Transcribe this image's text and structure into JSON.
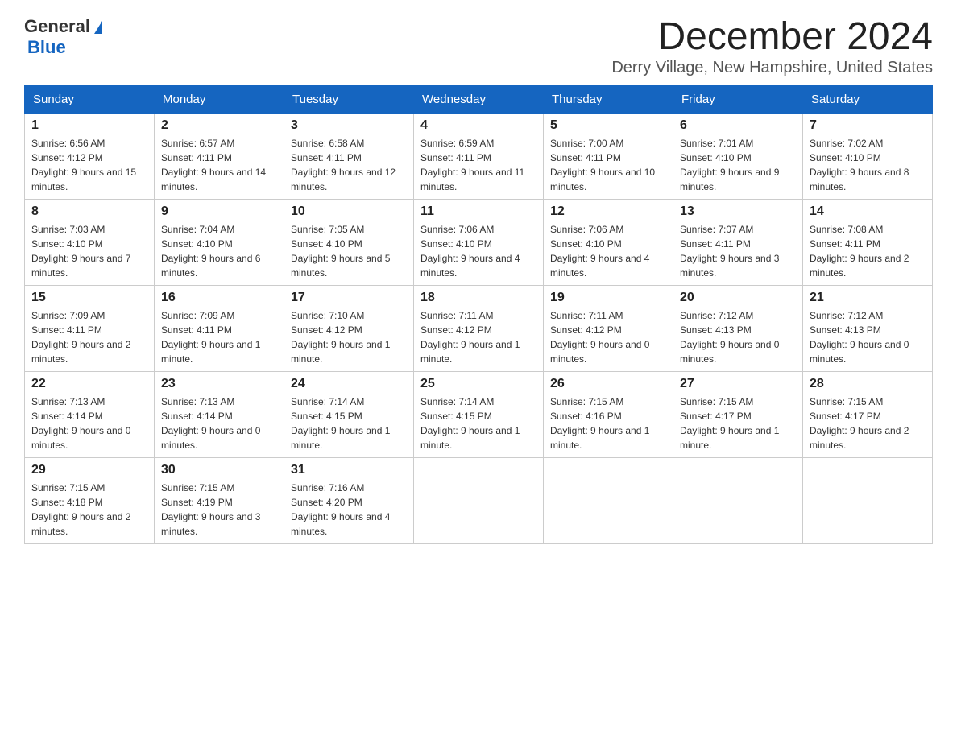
{
  "logo": {
    "text_general": "General",
    "text_blue": "Blue"
  },
  "header": {
    "month_title": "December 2024",
    "location": "Derry Village, New Hampshire, United States"
  },
  "weekdays": [
    "Sunday",
    "Monday",
    "Tuesday",
    "Wednesday",
    "Thursday",
    "Friday",
    "Saturday"
  ],
  "weeks": [
    [
      {
        "day": "1",
        "sunrise": "6:56 AM",
        "sunset": "4:12 PM",
        "daylight": "9 hours and 15 minutes."
      },
      {
        "day": "2",
        "sunrise": "6:57 AM",
        "sunset": "4:11 PM",
        "daylight": "9 hours and 14 minutes."
      },
      {
        "day": "3",
        "sunrise": "6:58 AM",
        "sunset": "4:11 PM",
        "daylight": "9 hours and 12 minutes."
      },
      {
        "day": "4",
        "sunrise": "6:59 AM",
        "sunset": "4:11 PM",
        "daylight": "9 hours and 11 minutes."
      },
      {
        "day": "5",
        "sunrise": "7:00 AM",
        "sunset": "4:11 PM",
        "daylight": "9 hours and 10 minutes."
      },
      {
        "day": "6",
        "sunrise": "7:01 AM",
        "sunset": "4:10 PM",
        "daylight": "9 hours and 9 minutes."
      },
      {
        "day": "7",
        "sunrise": "7:02 AM",
        "sunset": "4:10 PM",
        "daylight": "9 hours and 8 minutes."
      }
    ],
    [
      {
        "day": "8",
        "sunrise": "7:03 AM",
        "sunset": "4:10 PM",
        "daylight": "9 hours and 7 minutes."
      },
      {
        "day": "9",
        "sunrise": "7:04 AM",
        "sunset": "4:10 PM",
        "daylight": "9 hours and 6 minutes."
      },
      {
        "day": "10",
        "sunrise": "7:05 AM",
        "sunset": "4:10 PM",
        "daylight": "9 hours and 5 minutes."
      },
      {
        "day": "11",
        "sunrise": "7:06 AM",
        "sunset": "4:10 PM",
        "daylight": "9 hours and 4 minutes."
      },
      {
        "day": "12",
        "sunrise": "7:06 AM",
        "sunset": "4:10 PM",
        "daylight": "9 hours and 4 minutes."
      },
      {
        "day": "13",
        "sunrise": "7:07 AM",
        "sunset": "4:11 PM",
        "daylight": "9 hours and 3 minutes."
      },
      {
        "day": "14",
        "sunrise": "7:08 AM",
        "sunset": "4:11 PM",
        "daylight": "9 hours and 2 minutes."
      }
    ],
    [
      {
        "day": "15",
        "sunrise": "7:09 AM",
        "sunset": "4:11 PM",
        "daylight": "9 hours and 2 minutes."
      },
      {
        "day": "16",
        "sunrise": "7:09 AM",
        "sunset": "4:11 PM",
        "daylight": "9 hours and 1 minute."
      },
      {
        "day": "17",
        "sunrise": "7:10 AM",
        "sunset": "4:12 PM",
        "daylight": "9 hours and 1 minute."
      },
      {
        "day": "18",
        "sunrise": "7:11 AM",
        "sunset": "4:12 PM",
        "daylight": "9 hours and 1 minute."
      },
      {
        "day": "19",
        "sunrise": "7:11 AM",
        "sunset": "4:12 PM",
        "daylight": "9 hours and 0 minutes."
      },
      {
        "day": "20",
        "sunrise": "7:12 AM",
        "sunset": "4:13 PM",
        "daylight": "9 hours and 0 minutes."
      },
      {
        "day": "21",
        "sunrise": "7:12 AM",
        "sunset": "4:13 PM",
        "daylight": "9 hours and 0 minutes."
      }
    ],
    [
      {
        "day": "22",
        "sunrise": "7:13 AM",
        "sunset": "4:14 PM",
        "daylight": "9 hours and 0 minutes."
      },
      {
        "day": "23",
        "sunrise": "7:13 AM",
        "sunset": "4:14 PM",
        "daylight": "9 hours and 0 minutes."
      },
      {
        "day": "24",
        "sunrise": "7:14 AM",
        "sunset": "4:15 PM",
        "daylight": "9 hours and 1 minute."
      },
      {
        "day": "25",
        "sunrise": "7:14 AM",
        "sunset": "4:15 PM",
        "daylight": "9 hours and 1 minute."
      },
      {
        "day": "26",
        "sunrise": "7:15 AM",
        "sunset": "4:16 PM",
        "daylight": "9 hours and 1 minute."
      },
      {
        "day": "27",
        "sunrise": "7:15 AM",
        "sunset": "4:17 PM",
        "daylight": "9 hours and 1 minute."
      },
      {
        "day": "28",
        "sunrise": "7:15 AM",
        "sunset": "4:17 PM",
        "daylight": "9 hours and 2 minutes."
      }
    ],
    [
      {
        "day": "29",
        "sunrise": "7:15 AM",
        "sunset": "4:18 PM",
        "daylight": "9 hours and 2 minutes."
      },
      {
        "day": "30",
        "sunrise": "7:15 AM",
        "sunset": "4:19 PM",
        "daylight": "9 hours and 3 minutes."
      },
      {
        "day": "31",
        "sunrise": "7:16 AM",
        "sunset": "4:20 PM",
        "daylight": "9 hours and 4 minutes."
      },
      null,
      null,
      null,
      null
    ]
  ]
}
